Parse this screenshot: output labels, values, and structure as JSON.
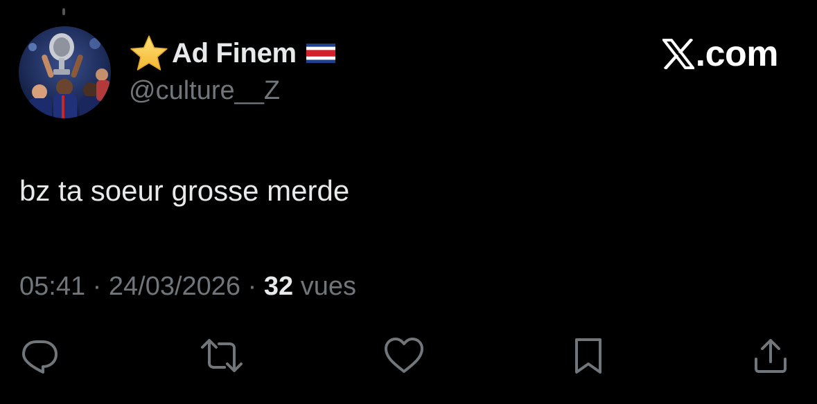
{
  "user": {
    "display_name": "Ad Finem",
    "handle": "@culture__Z",
    "badge_icon": "star-icon",
    "flag_icon": "costa-rica-flag-icon"
  },
  "brand": {
    "domain": "com",
    "separator": ".",
    "logo_icon": "x-logo-icon"
  },
  "tweet": {
    "text": "bz ta soeur grosse merde",
    "time": "05:41",
    "date": "24/03/2026",
    "views_count": "32",
    "views_label": "vues",
    "separator": " · "
  },
  "actions": [
    {
      "name": "reply",
      "icon": "reply-icon"
    },
    {
      "name": "retweet",
      "icon": "retweet-icon"
    },
    {
      "name": "like",
      "icon": "heart-icon"
    },
    {
      "name": "bookmark",
      "icon": "bookmark-icon"
    },
    {
      "name": "share",
      "icon": "share-icon"
    }
  ],
  "colors": {
    "background": "#000000",
    "primary_text": "#e7e9ea",
    "secondary_text": "#71767b",
    "icon": "#71767b",
    "star": "#f5c542"
  }
}
